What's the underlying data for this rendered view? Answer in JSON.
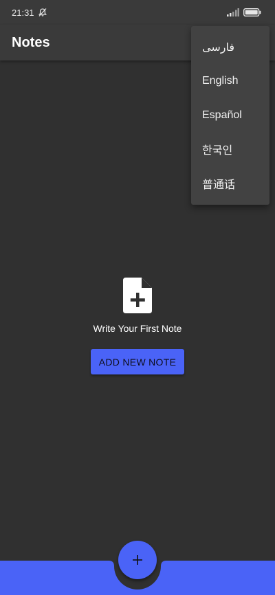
{
  "status_bar": {
    "time": "21:31",
    "icons": [
      "bell-off-icon",
      "signal-icon",
      "battery-icon"
    ]
  },
  "app_bar": {
    "title": "Notes"
  },
  "language_menu": {
    "items": [
      "فارسی",
      "English",
      "Español",
      "한국인",
      "普通话"
    ]
  },
  "empty_state": {
    "icon": "note-add-icon",
    "message": "Write Your First Note",
    "button_label": "ADD NEW NOTE"
  },
  "bottom_bar": {
    "fab_icon": "plus-icon"
  },
  "colors": {
    "background": "#303030",
    "app_bar": "#3a3a3a",
    "menu": "#424242",
    "accent": "#4a63f7"
  }
}
